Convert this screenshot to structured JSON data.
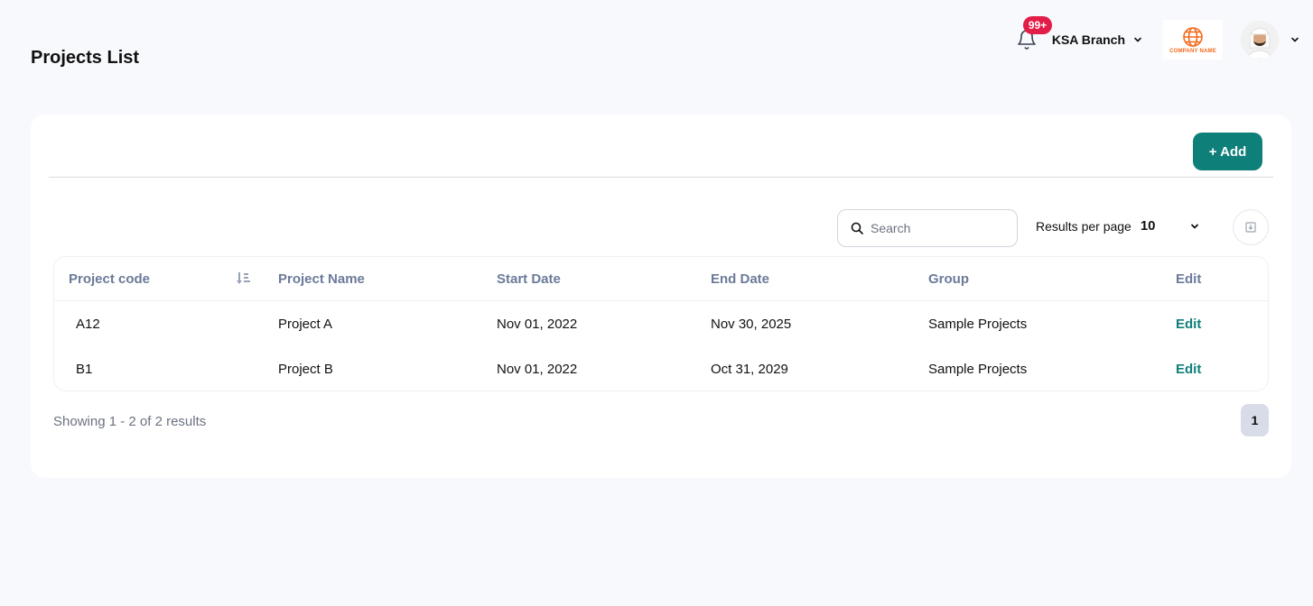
{
  "page": {
    "title": "Projects List"
  },
  "header": {
    "notifications_badge": "99+",
    "branch_label": "KSA Branch",
    "company_logo_text": "COMPANY NAME"
  },
  "toolbar": {
    "add_label": "+ Add",
    "search_placeholder": "Search",
    "results_per_page_label": "Results per page",
    "results_per_page_value": "10"
  },
  "table": {
    "headers": [
      "Project code",
      "Project Name",
      "Start Date",
      "End Date",
      "Group",
      "Edit"
    ],
    "rows": [
      {
        "code": "A12",
        "name": "Project A",
        "start": "Nov 01, 2022",
        "end": "Nov 30, 2025",
        "group": "Sample Projects",
        "edit": "Edit"
      },
      {
        "code": "B1",
        "name": "Project B",
        "start": "Nov 01, 2022",
        "end": "Oct 31, 2029",
        "group": "Sample Projects",
        "edit": "Edit"
      }
    ]
  },
  "footer": {
    "showing_text": "Showing 1 - 2 of 2 results",
    "current_page": "1"
  },
  "colors": {
    "accent": "#0f7f7a",
    "badge": "#e11d48",
    "background": "#f8f9fd"
  },
  "icons": [
    "bell-icon",
    "chevron-down-icon",
    "globe-logo",
    "avatar",
    "search-icon",
    "sort-icon",
    "export-icon"
  ]
}
